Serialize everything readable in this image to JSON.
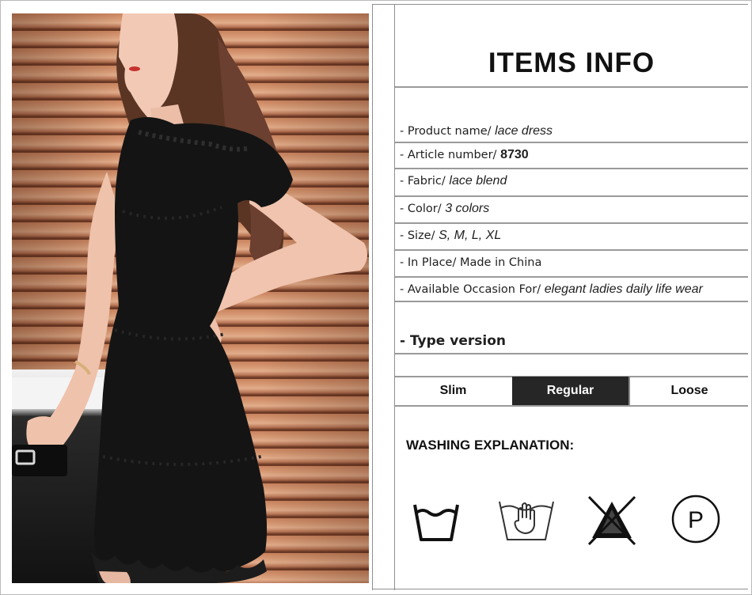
{
  "items_info": {
    "title": "ITEMS INFO",
    "rows": [
      {
        "label": "- Product name/ ",
        "value": "lace dress",
        "bold": false
      },
      {
        "label": "- Article number/ ",
        "value": "8730",
        "bold": true
      },
      {
        "label": "- Fabric/ ",
        "value": "lace blend",
        "bold": false
      },
      {
        "label": "- Color/ ",
        "value": "3 colors",
        "bold": false
      },
      {
        "label": "- Size/ ",
        "value": "S, M, L, XL",
        "bold": false
      },
      {
        "label": "- In Place/ Made in China",
        "value": "",
        "bold": false
      },
      {
        "label": "- Available Occasion For/ ",
        "value": "elegant ladies daily life wear",
        "bold": false
      }
    ]
  },
  "type_version": {
    "heading": "- Type version",
    "options": [
      "Slim",
      "Regular",
      "Loose"
    ],
    "selected": "Regular",
    "selected_bg": "#262626"
  },
  "washing": {
    "title": "WASHING EXPLANATION:",
    "icons": [
      "machine-wash-icon",
      "hand-wash-icon",
      "do-not-bleach-icon",
      "professional-dry-clean-icon"
    ]
  },
  "photo": {
    "icon": "model-photo",
    "colors": {
      "dress": "#141414",
      "blinds": "#c9835e",
      "skin": "#f2c9b5",
      "hair": "#5a3524"
    }
  }
}
